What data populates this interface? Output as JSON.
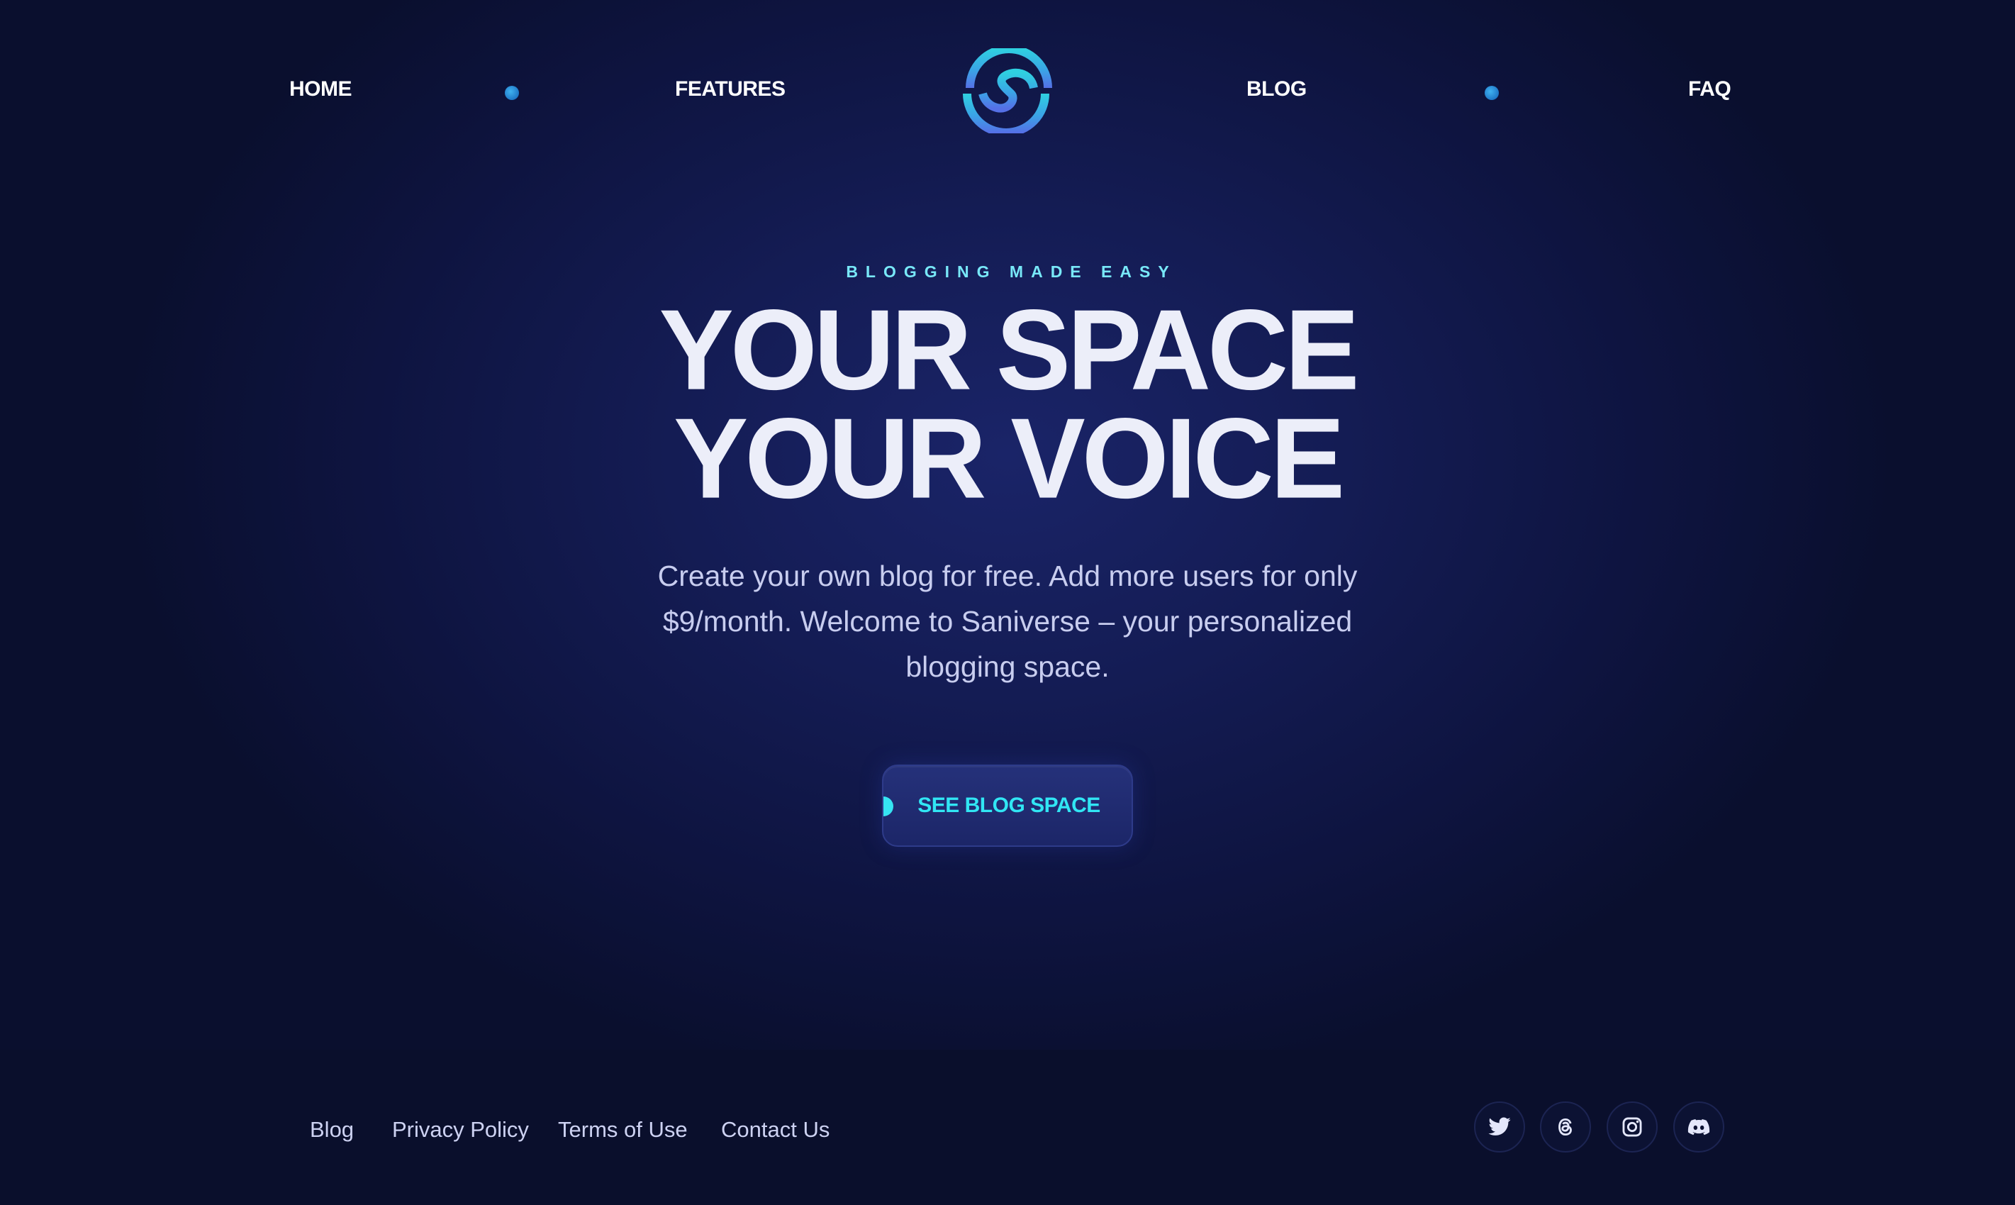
{
  "nav": {
    "home_label": "HOME",
    "features_label": "FEATURES",
    "blog_label": "BLOG",
    "faq_label": "FAQ",
    "logo_icon": "saniverse-s-logo-icon",
    "dot_icon": "nav-dot-icon"
  },
  "hero": {
    "eyebrow": "BLOGGING MADE EASY",
    "headline_line1": "YOUR SPACE",
    "headline_line2": "YOUR VOICE",
    "subtitle": "Create your own blog for free. Add more users for only $9/month. Welcome to Saniverse – your personalized blogging space.",
    "cta_label": "SEE BLOG SPACE"
  },
  "footer": {
    "links": [
      "Blog",
      "Privacy Policy",
      "Terms of Use",
      "Contact Us"
    ],
    "social_icons": [
      "twitter-icon",
      "threads-icon",
      "instagram-icon",
      "discord-icon"
    ]
  },
  "colors": {
    "background": "#0a0f2c",
    "hero_glow": "#1a2468",
    "accent_cyan": "#31e6f4",
    "eyebrow": "#78e8f8",
    "headline": "#eceef9",
    "body_text": "#c8cdef",
    "cta_bg": "#25317a"
  }
}
